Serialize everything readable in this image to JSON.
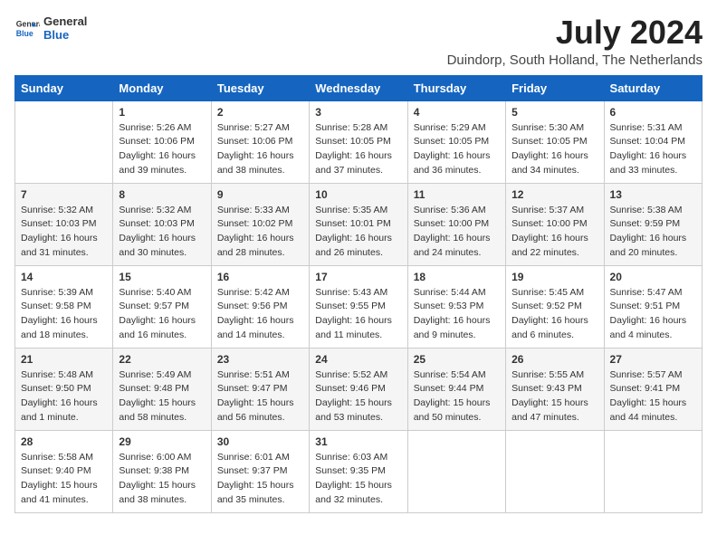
{
  "logo": {
    "general": "General",
    "blue": "Blue"
  },
  "title": "July 2024",
  "location": "Duindorp, South Holland, The Netherlands",
  "days_header": [
    "Sunday",
    "Monday",
    "Tuesday",
    "Wednesday",
    "Thursday",
    "Friday",
    "Saturday"
  ],
  "weeks": [
    [
      {
        "day": "",
        "info": ""
      },
      {
        "day": "1",
        "info": "Sunrise: 5:26 AM\nSunset: 10:06 PM\nDaylight: 16 hours\nand 39 minutes."
      },
      {
        "day": "2",
        "info": "Sunrise: 5:27 AM\nSunset: 10:06 PM\nDaylight: 16 hours\nand 38 minutes."
      },
      {
        "day": "3",
        "info": "Sunrise: 5:28 AM\nSunset: 10:05 PM\nDaylight: 16 hours\nand 37 minutes."
      },
      {
        "day": "4",
        "info": "Sunrise: 5:29 AM\nSunset: 10:05 PM\nDaylight: 16 hours\nand 36 minutes."
      },
      {
        "day": "5",
        "info": "Sunrise: 5:30 AM\nSunset: 10:05 PM\nDaylight: 16 hours\nand 34 minutes."
      },
      {
        "day": "6",
        "info": "Sunrise: 5:31 AM\nSunset: 10:04 PM\nDaylight: 16 hours\nand 33 minutes."
      }
    ],
    [
      {
        "day": "7",
        "info": "Sunrise: 5:32 AM\nSunset: 10:03 PM\nDaylight: 16 hours\nand 31 minutes."
      },
      {
        "day": "8",
        "info": "Sunrise: 5:32 AM\nSunset: 10:03 PM\nDaylight: 16 hours\nand 30 minutes."
      },
      {
        "day": "9",
        "info": "Sunrise: 5:33 AM\nSunset: 10:02 PM\nDaylight: 16 hours\nand 28 minutes."
      },
      {
        "day": "10",
        "info": "Sunrise: 5:35 AM\nSunset: 10:01 PM\nDaylight: 16 hours\nand 26 minutes."
      },
      {
        "day": "11",
        "info": "Sunrise: 5:36 AM\nSunset: 10:00 PM\nDaylight: 16 hours\nand 24 minutes."
      },
      {
        "day": "12",
        "info": "Sunrise: 5:37 AM\nSunset: 10:00 PM\nDaylight: 16 hours\nand 22 minutes."
      },
      {
        "day": "13",
        "info": "Sunrise: 5:38 AM\nSunset: 9:59 PM\nDaylight: 16 hours\nand 20 minutes."
      }
    ],
    [
      {
        "day": "14",
        "info": "Sunrise: 5:39 AM\nSunset: 9:58 PM\nDaylight: 16 hours\nand 18 minutes."
      },
      {
        "day": "15",
        "info": "Sunrise: 5:40 AM\nSunset: 9:57 PM\nDaylight: 16 hours\nand 16 minutes."
      },
      {
        "day": "16",
        "info": "Sunrise: 5:42 AM\nSunset: 9:56 PM\nDaylight: 16 hours\nand 14 minutes."
      },
      {
        "day": "17",
        "info": "Sunrise: 5:43 AM\nSunset: 9:55 PM\nDaylight: 16 hours\nand 11 minutes."
      },
      {
        "day": "18",
        "info": "Sunrise: 5:44 AM\nSunset: 9:53 PM\nDaylight: 16 hours\nand 9 minutes."
      },
      {
        "day": "19",
        "info": "Sunrise: 5:45 AM\nSunset: 9:52 PM\nDaylight: 16 hours\nand 6 minutes."
      },
      {
        "day": "20",
        "info": "Sunrise: 5:47 AM\nSunset: 9:51 PM\nDaylight: 16 hours\nand 4 minutes."
      }
    ],
    [
      {
        "day": "21",
        "info": "Sunrise: 5:48 AM\nSunset: 9:50 PM\nDaylight: 16 hours\nand 1 minute."
      },
      {
        "day": "22",
        "info": "Sunrise: 5:49 AM\nSunset: 9:48 PM\nDaylight: 15 hours\nand 58 minutes."
      },
      {
        "day": "23",
        "info": "Sunrise: 5:51 AM\nSunset: 9:47 PM\nDaylight: 15 hours\nand 56 minutes."
      },
      {
        "day": "24",
        "info": "Sunrise: 5:52 AM\nSunset: 9:46 PM\nDaylight: 15 hours\nand 53 minutes."
      },
      {
        "day": "25",
        "info": "Sunrise: 5:54 AM\nSunset: 9:44 PM\nDaylight: 15 hours\nand 50 minutes."
      },
      {
        "day": "26",
        "info": "Sunrise: 5:55 AM\nSunset: 9:43 PM\nDaylight: 15 hours\nand 47 minutes."
      },
      {
        "day": "27",
        "info": "Sunrise: 5:57 AM\nSunset: 9:41 PM\nDaylight: 15 hours\nand 44 minutes."
      }
    ],
    [
      {
        "day": "28",
        "info": "Sunrise: 5:58 AM\nSunset: 9:40 PM\nDaylight: 15 hours\nand 41 minutes."
      },
      {
        "day": "29",
        "info": "Sunrise: 6:00 AM\nSunset: 9:38 PM\nDaylight: 15 hours\nand 38 minutes."
      },
      {
        "day": "30",
        "info": "Sunrise: 6:01 AM\nSunset: 9:37 PM\nDaylight: 15 hours\nand 35 minutes."
      },
      {
        "day": "31",
        "info": "Sunrise: 6:03 AM\nSunset: 9:35 PM\nDaylight: 15 hours\nand 32 minutes."
      },
      {
        "day": "",
        "info": ""
      },
      {
        "day": "",
        "info": ""
      },
      {
        "day": "",
        "info": ""
      }
    ]
  ]
}
